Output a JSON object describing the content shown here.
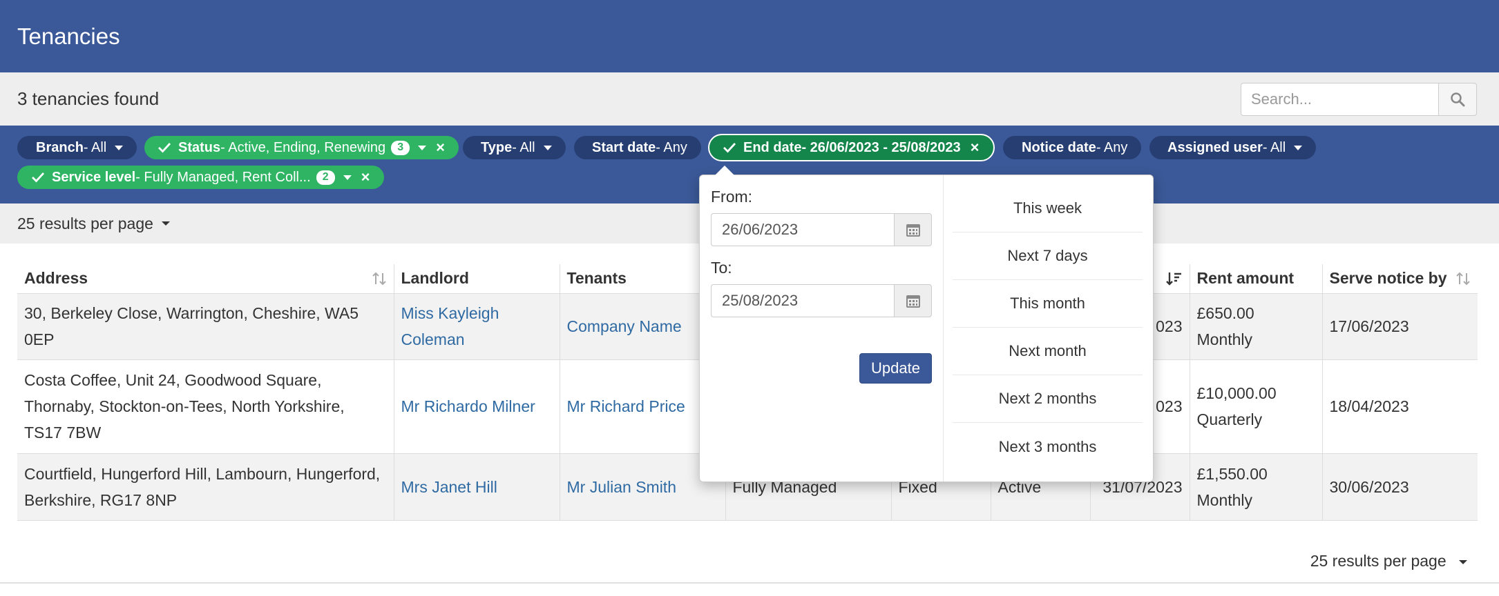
{
  "header": {
    "title": "Tenancies"
  },
  "results": {
    "count_text": "3 tenancies found",
    "search_placeholder": "Search..."
  },
  "filters": [
    {
      "label": "Branch",
      "value": " - All"
    },
    {
      "label": "Status",
      "value": " - Active, Ending, Renewing",
      "count": "3"
    },
    {
      "label": "Type",
      "value": " - All"
    },
    {
      "label": "Start date",
      "value": " - Any"
    },
    {
      "label": "End date",
      "value": " - 26/06/2023 - 25/08/2023"
    },
    {
      "label": "Notice date",
      "value": " - Any"
    },
    {
      "label": "Assigned user",
      "value": " - All"
    },
    {
      "label": "Service level",
      "value": " - Fully Managed, Rent Coll...",
      "count": "2"
    }
  ],
  "per_page": {
    "label": "25 results per page"
  },
  "table": {
    "columns": [
      "Address",
      "Landlord",
      "Tenants",
      "",
      "",
      "",
      "",
      "Rent amount",
      "Serve notice by"
    ],
    "rows": [
      {
        "address": "30, Berkeley Close, Warrington, Cheshire, WA5 0EP",
        "landlord": "Miss Kayleigh Coleman",
        "tenants": "Company Name",
        "service": "",
        "type": "",
        "status": "",
        "end_date": "023",
        "rent": "£650.00",
        "freq": "Monthly",
        "notice": "17/06/2023"
      },
      {
        "address": "Costa Coffee, Unit 24, Goodwood Square, Thornaby, Stockton-on-Tees, North Yorkshire, TS17 7BW",
        "landlord": "Mr Richardo Milner",
        "tenants": "Mr Richard Price",
        "service": "",
        "type": "",
        "status": "",
        "end_date": "023",
        "rent": "£10,000.00",
        "freq": "Quarterly",
        "notice": "18/04/2023"
      },
      {
        "address": "Courtfield, Hungerford Hill, Lambourn, Hungerford, Berkshire, RG17 8NP",
        "landlord": "Mrs Janet Hill",
        "tenants": "Mr Julian Smith",
        "service": "Fully Managed",
        "type": "Fixed",
        "status": "Active",
        "end_date": "31/07/2023",
        "rent": "£1,550.00",
        "freq": "Monthly",
        "notice": "30/06/2023"
      }
    ]
  },
  "popover": {
    "from_label": "From:",
    "from_value": "26/06/2023",
    "to_label": "To:",
    "to_value": "25/08/2023",
    "update_label": "Update",
    "quick_options": [
      "This week",
      "Next 7 days",
      "This month",
      "Next month",
      "Next 2 months",
      "Next 3 months"
    ]
  },
  "footer": {
    "per_page_label": "25 results per page"
  },
  "colors": {
    "header_blue": "#3b5998",
    "pill_dark": "#263e72",
    "pill_green": "#2eb463",
    "pill_active": "#14864b",
    "link": "#2f6aa3"
  },
  "icons": {
    "search": "magnifier-icon",
    "calendar": "calendar-icon",
    "check": "check-icon",
    "remove": "close-icon",
    "sort": "sort-icon"
  }
}
